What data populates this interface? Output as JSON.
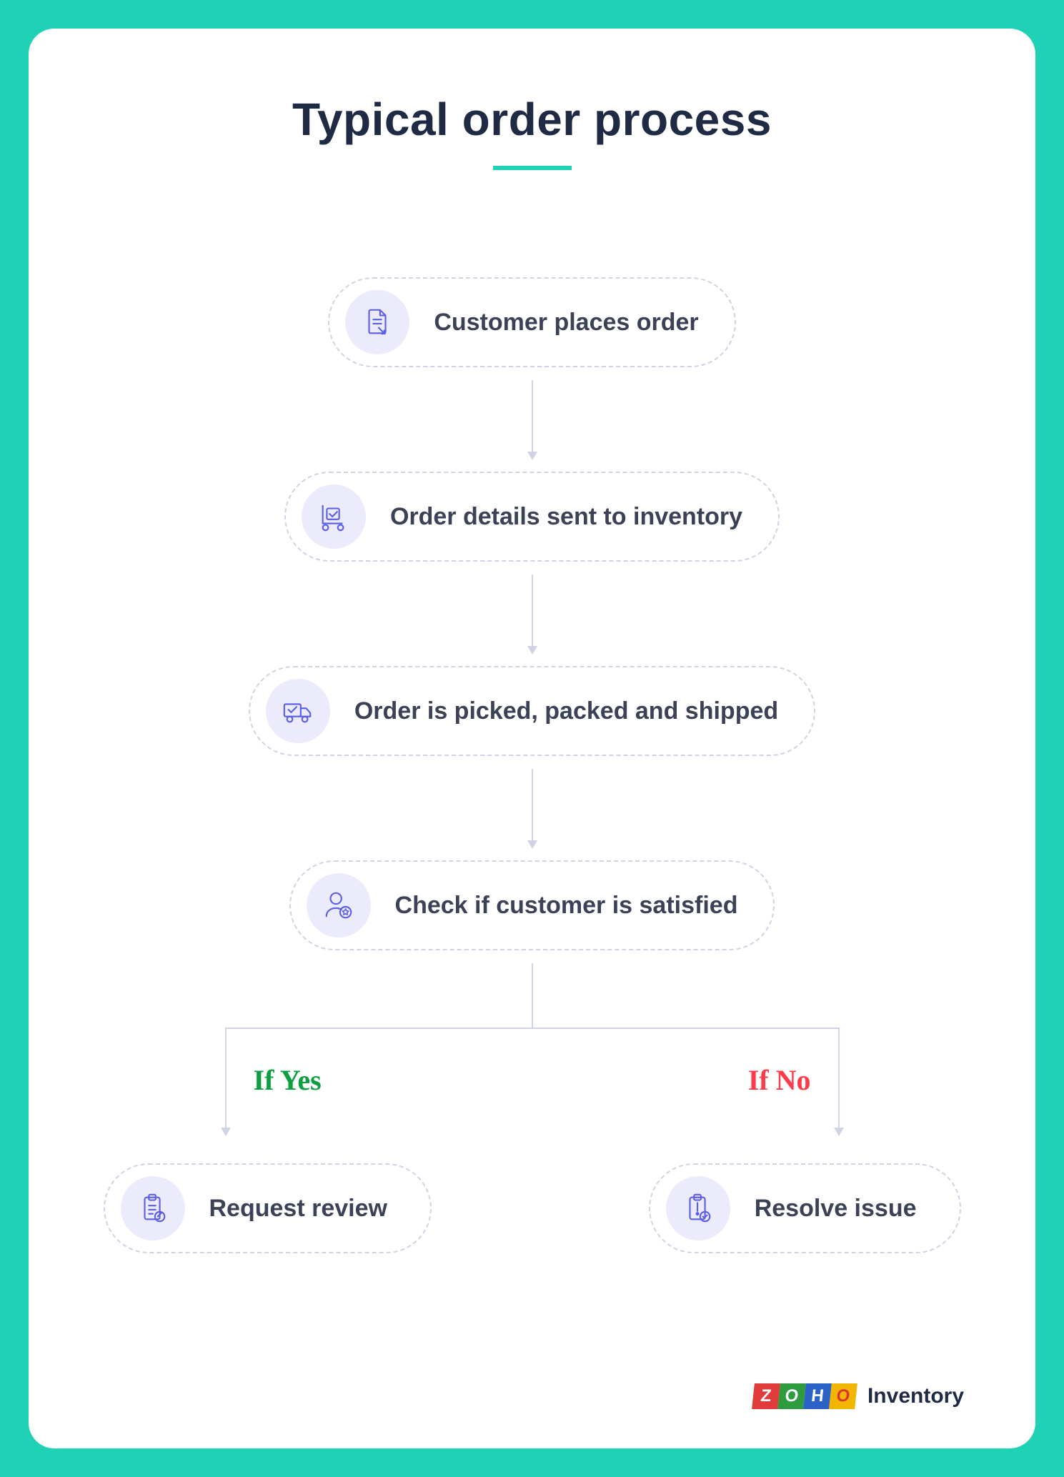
{
  "title": "Typical order process",
  "steps": [
    {
      "label": "Customer places order",
      "icon": "document-click-icon"
    },
    {
      "label": "Order details sent to inventory",
      "icon": "trolley-icon"
    },
    {
      "label": "Order is picked, packed and shipped",
      "icon": "truck-check-icon"
    },
    {
      "label": "Check if customer is satisfied",
      "icon": "user-star-icon"
    }
  ],
  "branch": {
    "yes_label": "If Yes",
    "no_label": "If No"
  },
  "outcomes": {
    "yes": {
      "label": "Request review",
      "icon": "clipboard-edit-icon"
    },
    "no": {
      "label": "Resolve issue",
      "icon": "clipboard-alert-icon"
    }
  },
  "footer": {
    "brand_letters": [
      "Z",
      "O",
      "H",
      "O"
    ],
    "product": "Inventory"
  },
  "colors": {
    "bg": "#1fd1b5",
    "border": "#cfd3e3",
    "icon_bg": "#ecebfb",
    "icon_stroke": "#5a5ee6",
    "yes": "#0a9f3f",
    "no": "#ff3a4a",
    "text": "#1f2a44"
  }
}
